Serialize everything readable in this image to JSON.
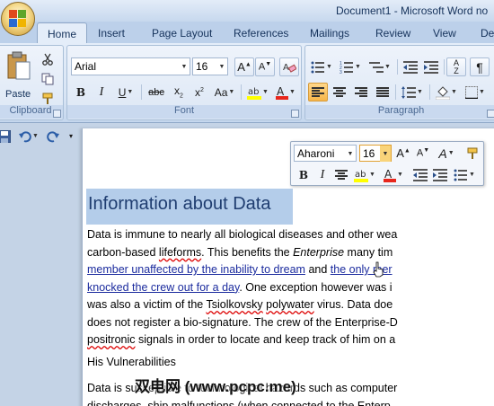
{
  "window": {
    "title": "Document1 - Microsoft Word no"
  },
  "tabs": [
    "Home",
    "Insert",
    "Page Layout",
    "References",
    "Mailings",
    "Review",
    "View",
    "De"
  ],
  "ribbon": {
    "clipboard": {
      "label": "Clipboard",
      "paste_label": "Paste"
    },
    "font": {
      "label": "Font",
      "font_name": "Arial",
      "font_size": "16"
    },
    "paragraph": {
      "label": "Paragraph"
    }
  },
  "mini_toolbar": {
    "font_name": "Aharoni",
    "font_size": "16"
  },
  "document": {
    "heading": "Information about Data",
    "lines": [
      [
        {
          "t": "Data is immune to nearly all biological diseases and other wea"
        }
      ],
      [
        {
          "t": "carbon-based "
        },
        {
          "t": "lifeforms",
          "s": "squig"
        },
        {
          "t": ". This benefits the "
        },
        {
          "t": "Enterprise",
          "s": "ital"
        },
        {
          "t": " many tim"
        }
      ],
      [
        {
          "t": "member unaffected by the inability to dream",
          "s": "link"
        },
        {
          "t": " and "
        },
        {
          "t": "the only mer",
          "s": "link"
        }
      ],
      [
        {
          "t": "knocked the crew out for a day",
          "s": "link"
        },
        {
          "t": ". One exception however was i"
        }
      ],
      [
        {
          "t": "was also a victim of the "
        },
        {
          "t": "Tsiolkovsky",
          "s": "squig"
        },
        {
          "t": " "
        },
        {
          "t": "polywater",
          "s": "squig"
        },
        {
          "t": " virus. Data doe"
        }
      ],
      [
        {
          "t": "does not register a bio-signature. The crew of the Enterprise-D"
        }
      ],
      [
        {
          "t": "positronic",
          "s": "squig"
        },
        {
          "t": " signals in order to locate and keep track of him on a"
        }
      ]
    ],
    "subheading": "His Vulnerabilities",
    "tail_lines": [
      [
        {
          "t": "Data is susceptible to technological hazards such as computer"
        }
      ],
      [
        {
          "t": "discharges, ship malfunctions (when connected to the Enterp"
        }
      ]
    ]
  },
  "watermark": "双电网 (www.pcpc.me)"
}
